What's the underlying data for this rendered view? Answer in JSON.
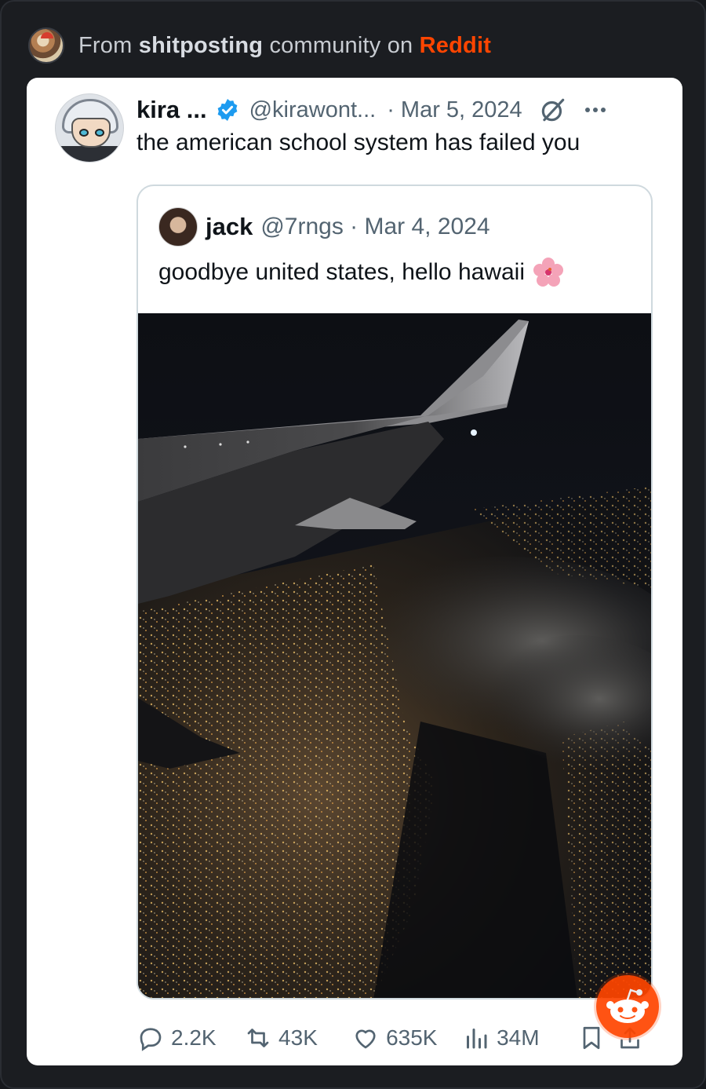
{
  "header": {
    "prefix": "From",
    "community": "shitposting",
    "middle": "community on",
    "platform": "Reddit"
  },
  "tweet": {
    "display_name": "kira ...",
    "handle": "@kirawont...",
    "date": "· Mar 5, 2024",
    "text": "the american school system has failed you"
  },
  "quote": {
    "display_name": "jack",
    "handle": "@7rngs · Mar 4, 2024",
    "text": "goodbye united states, hello hawaii",
    "emoji": "hibiscus-icon"
  },
  "metrics": {
    "replies": "2.2K",
    "reposts": "43K",
    "likes": "635K",
    "views": "34M"
  },
  "colors": {
    "reddit_orange": "#ff4500",
    "verified_blue": "#1d9bf0",
    "muted_text": "#536471"
  }
}
